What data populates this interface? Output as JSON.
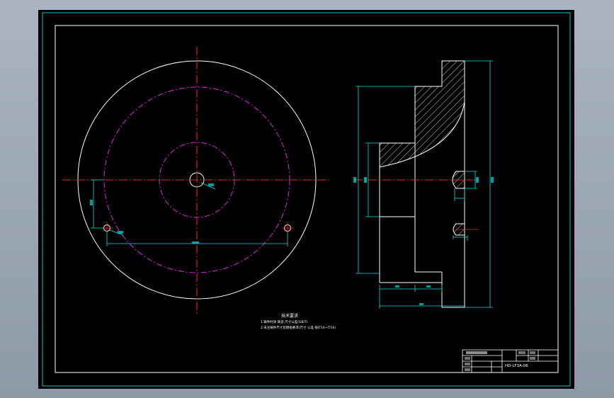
{
  "drawing": {
    "colors": {
      "background": "#000000",
      "outline": "#ffffff",
      "dimension": "#00e0e0",
      "centerline": "#ff2020",
      "pitch_circle": "#e020e0",
      "text": "#ffffff",
      "hatch": "#ffffff",
      "frame": "#ffffff",
      "inner_frame": "#00c8c8"
    },
    "notes": {
      "heading": "技术要求",
      "line1": "1.铸件时效 铸造 尺寸公差(GB/T)",
      "line2": "2.未注铸件尺寸及倒角要求(尺寸 公差 按IT14~IT16)"
    },
    "title_block": {
      "part_name": "HD-LF3A-06"
    }
  }
}
